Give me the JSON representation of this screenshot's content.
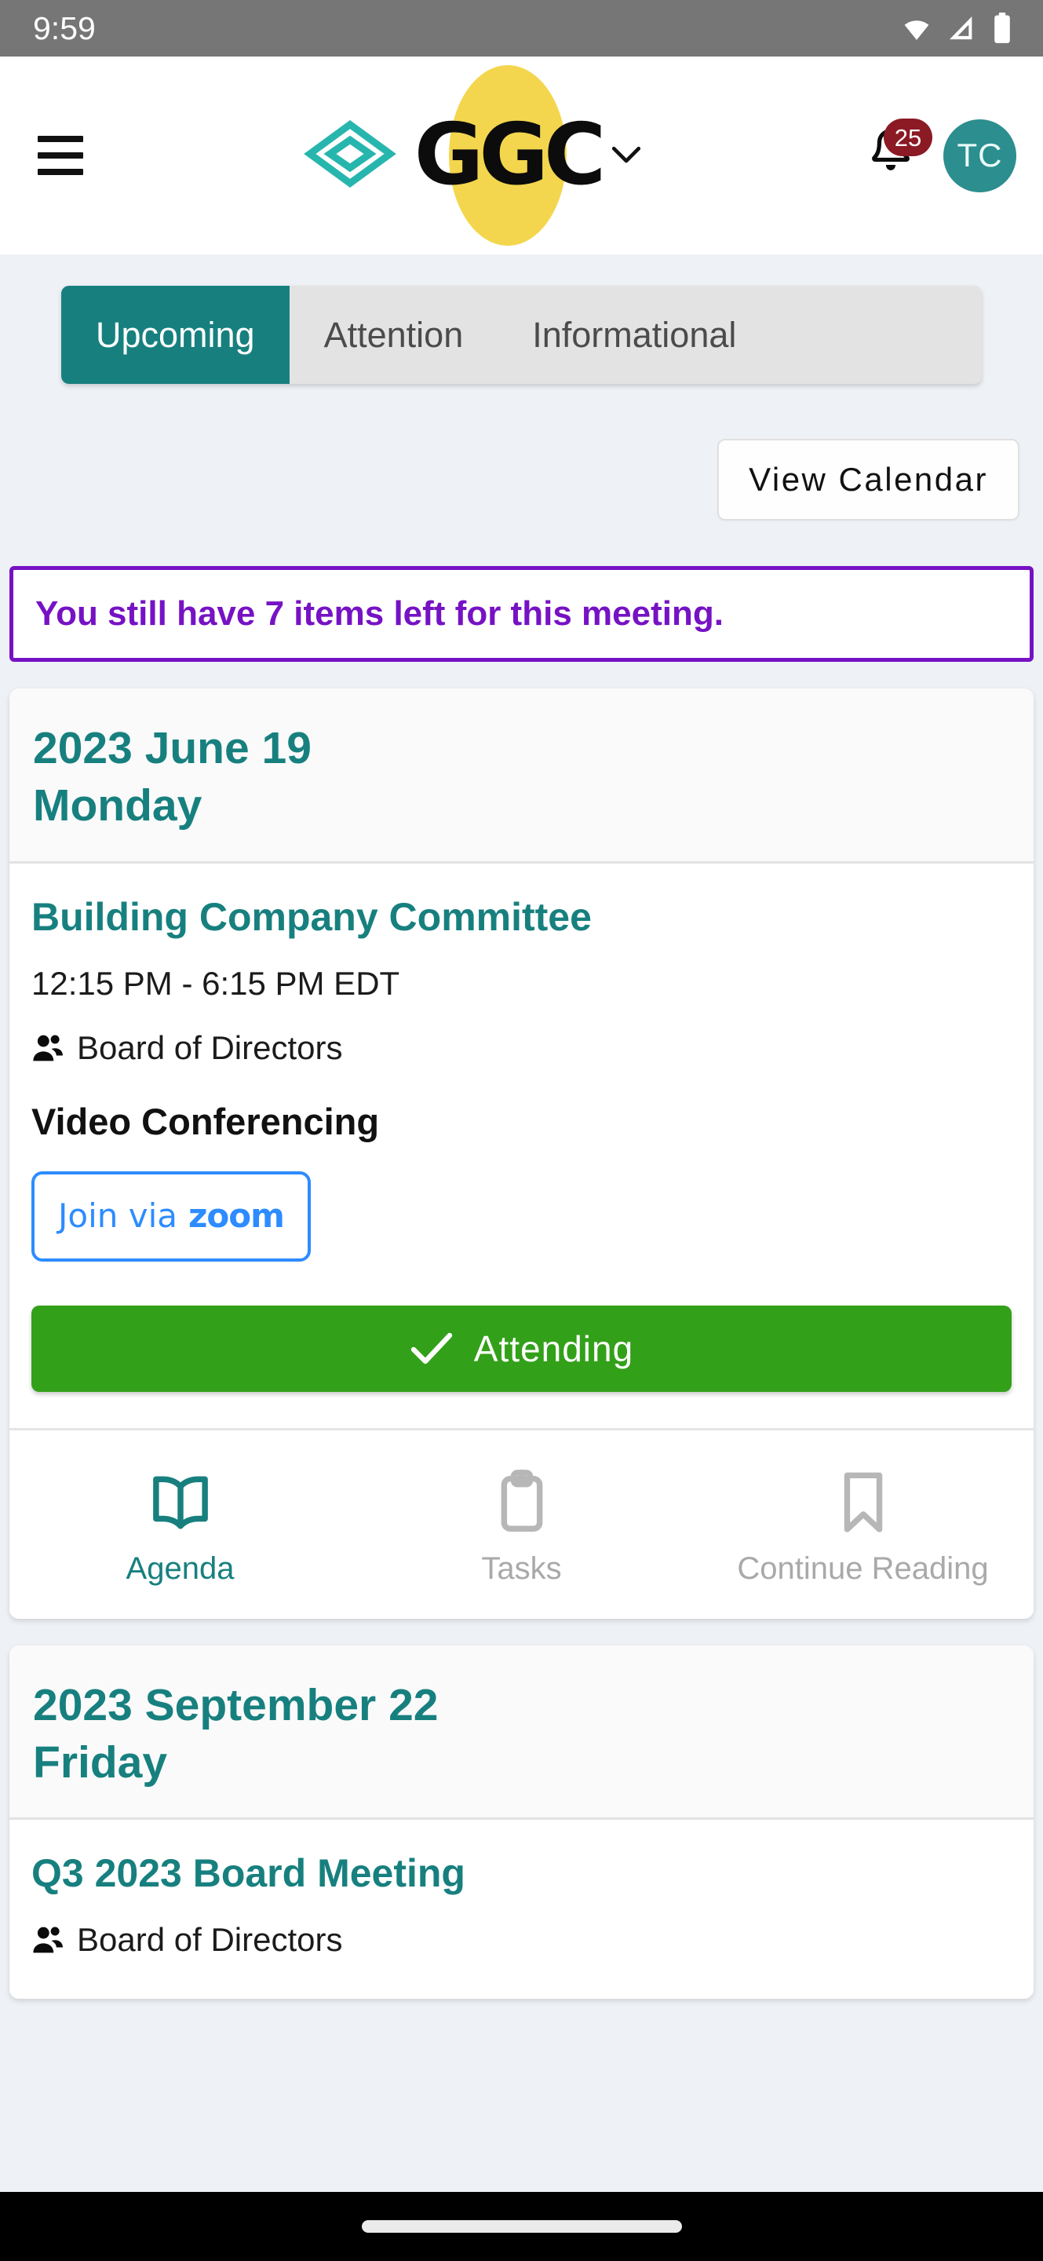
{
  "status_bar": {
    "clock": "9:59",
    "icons": [
      "wifi-icon",
      "cellular-signal-icon",
      "battery-icon"
    ]
  },
  "header": {
    "menu_icon": "hamburger-menu-icon",
    "brand_mark_icon": "ggc-diamond-logo-icon",
    "brand_text": "GGC",
    "brand_caret_icon": "chevron-down-icon",
    "notifications": {
      "icon": "bell-icon",
      "badge_count": "25"
    },
    "avatar_initials": "TC"
  },
  "tabs": [
    {
      "label": "Upcoming",
      "active": true
    },
    {
      "label": "Attention",
      "active": false
    },
    {
      "label": "Informational",
      "active": false
    }
  ],
  "toolbar": {
    "view_calendar_label": "View Calendar"
  },
  "alert": {
    "message": "You still have 7 items left for this meeting."
  },
  "meetings": [
    {
      "date_line1": "2023 June 19",
      "date_line2": "Monday",
      "title": "Building Company Committee",
      "time": "12:15 PM - 6:15 PM EDT",
      "group_icon": "users-icon",
      "group": "Board of Directors",
      "video_conferencing_heading": "Video Conferencing",
      "join_prefix": "Join via",
      "join_provider": "zoom",
      "attending_label": "Attending",
      "attending_icon": "check-icon",
      "actions": [
        {
          "label": "Agenda",
          "icon": "book-open-icon",
          "state": "active"
        },
        {
          "label": "Tasks",
          "icon": "clipboard-icon",
          "state": "muted"
        },
        {
          "label": "Continue Reading",
          "icon": "bookmark-icon",
          "state": "muted"
        }
      ]
    },
    {
      "date_line1": "2023 September 22",
      "date_line2": "Friday",
      "title": "Q3 2023 Board Meeting",
      "group_icon": "users-icon",
      "group": "Board of Directors"
    }
  ],
  "colors": {
    "brand_teal": "#17807f",
    "brand_yellow": "#f3d64d",
    "brand_mark_teal": "#27b6ae",
    "alert_purple": "#7612c4",
    "attending_green": "#33a019",
    "badge_red": "#8b1a25",
    "zoom_blue": "#2d8cff",
    "page_bg": "#eef1f5",
    "status_bar_bg": "#767676"
  }
}
